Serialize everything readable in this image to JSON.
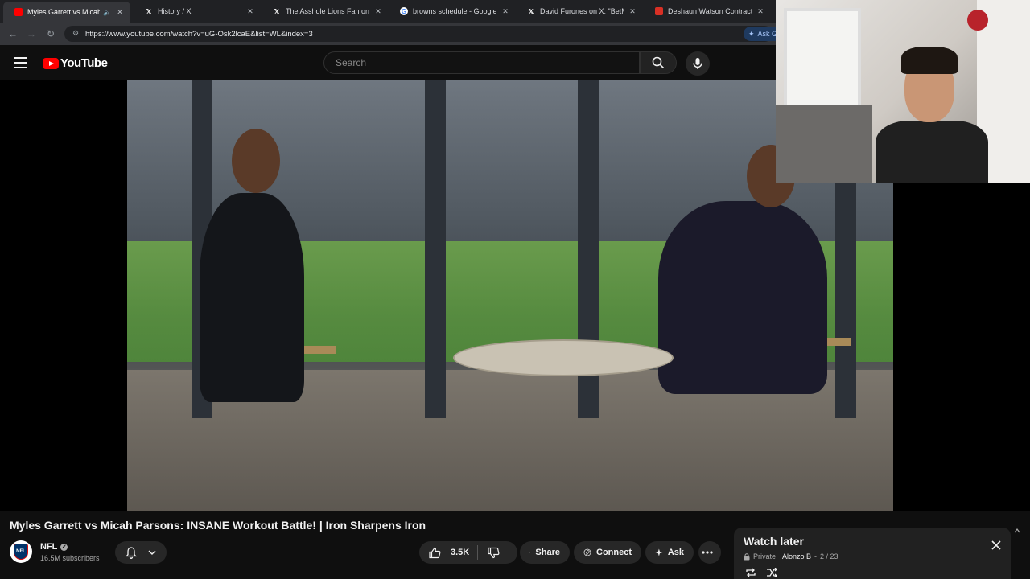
{
  "browser": {
    "tabs": [
      {
        "title": "Myles Garrett vs Micah Pars",
        "favicon": "youtube-icon",
        "active": true
      },
      {
        "title": "History / X",
        "favicon": "x-icon"
      },
      {
        "title": "The Asshole Lions Fan on X: \"ht",
        "favicon": "x-icon"
      },
      {
        "title": "browns schedule - Google Sear",
        "favicon": "google-icon"
      },
      {
        "title": "David Furones on X: \"BetMGM",
        "favicon": "x-icon"
      },
      {
        "title": "Deshaun Watson Contract, Sala",
        "favicon": "web-icon"
      }
    ],
    "url": "https://www.youtube.com/watch?v=uG-Osk2lcaE&list=WL&index=3",
    "ask_label": "Ask G"
  },
  "masthead": {
    "logo_text": "YouTube",
    "search_placeholder": "Search"
  },
  "video": {
    "title": "Myles Garrett vs Micah Parsons: INSANE Workout Battle! | Iron Sharpens Iron"
  },
  "channel": {
    "name": "NFL",
    "subscribers": "16.5M subscribers",
    "avatar_text": "NFL"
  },
  "actions": {
    "like_count": "3.5K",
    "share_label": "Share",
    "connect_label": "Connect",
    "ask_label": "Ask"
  },
  "watch_later": {
    "title": "Watch later",
    "privacy": "Private",
    "owner": "Alonzo B",
    "position": "2 / 23"
  },
  "colors": {
    "background": "#0f0f0f",
    "brand_red": "#ff0000",
    "pill_bg": "#272727",
    "panel_bg": "#212121"
  }
}
